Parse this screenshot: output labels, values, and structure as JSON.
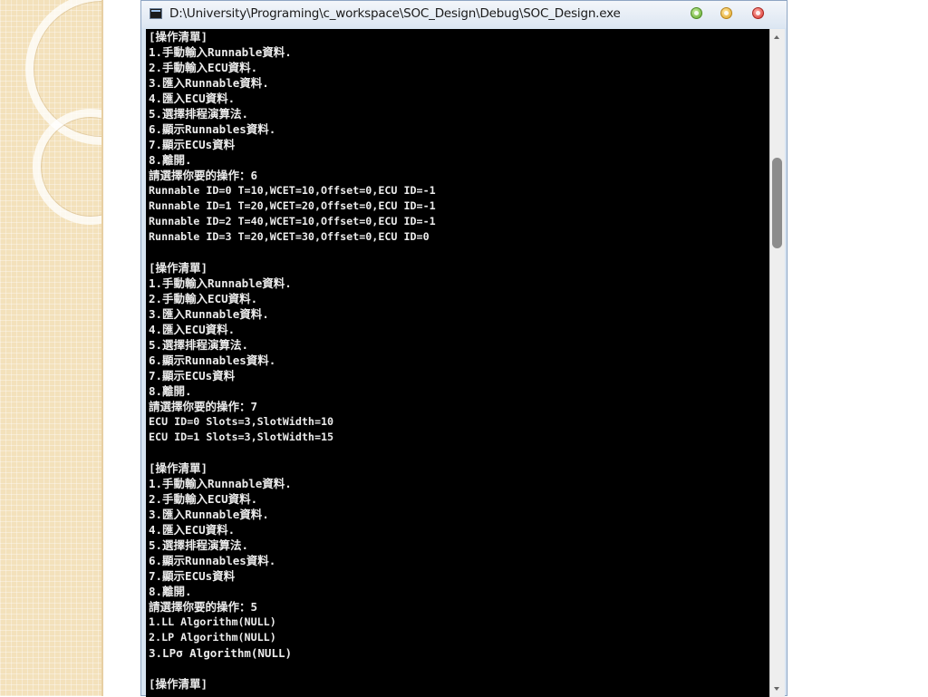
{
  "window": {
    "title": "D:\\University\\Programing\\c_workspace\\SOC_Design\\Debug\\SOC_Design.exe"
  },
  "console": {
    "lines": [
      "[操作清單]",
      "1.手動輸入Runnable資料.",
      "2.手動輸入ECU資料.",
      "3.匯入Runnable資料.",
      "4.匯入ECU資料.",
      "5.選擇排程演算法.",
      "6.顯示Runnables資料.",
      "7.顯示ECUs資料",
      "8.離開.",
      "請選擇你要的操作：6",
      "Runnable ID=0 T=10,WCET=10,Offset=0,ECU ID=-1",
      "Runnable ID=1 T=20,WCET=20,Offset=0,ECU ID=-1",
      "Runnable ID=2 T=40,WCET=10,Offset=0,ECU ID=-1",
      "Runnable ID=3 T=20,WCET=30,Offset=0,ECU ID=0",
      "",
      "[操作清單]",
      "1.手動輸入Runnable資料.",
      "2.手動輸入ECU資料.",
      "3.匯入Runnable資料.",
      "4.匯入ECU資料.",
      "5.選擇排程演算法.",
      "6.顯示Runnables資料.",
      "7.顯示ECUs資料",
      "8.離開.",
      "請選擇你要的操作：7",
      "ECU ID=0 Slots=3,SlotWidth=10",
      "ECU ID=1 Slots=3,SlotWidth=15",
      "",
      "[操作清單]",
      "1.手動輸入Runnable資料.",
      "2.手動輸入ECU資料.",
      "3.匯入Runnable資料.",
      "4.匯入ECU資料.",
      "5.選擇排程演算法.",
      "6.顯示Runnables資料.",
      "7.顯示ECUs資料",
      "8.離開.",
      "請選擇你要的操作：5",
      "1.LL Algorithm(NULL)",
      "2.LP Algorithm(NULL)",
      "3.LPσ Algorithm(NULL)",
      "",
      "[操作清單]"
    ]
  },
  "icons": {
    "app": "console-app-icon",
    "minimize": "minimize-icon",
    "maximize": "maximize-icon",
    "close": "close-icon"
  },
  "colors": {
    "console_bg": "#000000",
    "console_text": "#ececec",
    "minimize": "#5ea82a",
    "maximize": "#e0a222",
    "close": "#d6302a"
  }
}
